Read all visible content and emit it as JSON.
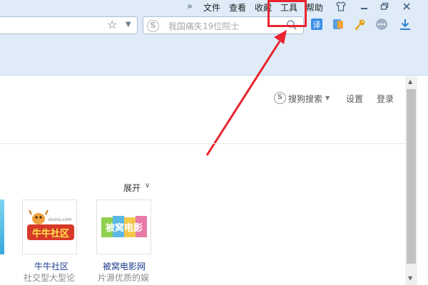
{
  "menubar": {
    "overflow_chevron": "»",
    "items": [
      "文件",
      "查看",
      "收藏",
      "工具",
      "帮助"
    ],
    "window_controls": [
      "shirt-icon",
      "minimize-icon",
      "restore-icon",
      "close-icon"
    ]
  },
  "toolbar": {
    "search_placeholder": "我国痛失19位院士",
    "search_logo_glyph": "S",
    "addon_icons": [
      "translate-icon",
      "sidebar-icon",
      "key-icon",
      "more-icon",
      "download-icon"
    ]
  },
  "highlight": {
    "target": "工具",
    "color": "#e8242f"
  },
  "page": {
    "sogou_search_label": "搜狗搜索",
    "settings_label": "设置",
    "login_label": "登录",
    "expand_label": "展开",
    "tiles": [
      {
        "logo_text": "牛牛社区",
        "logo_small": "niuniu.com",
        "name": "牛牛社区",
        "desc": "社交型大型论"
      },
      {
        "logo_text": "被窝电影",
        "name": "被窝电影网",
        "desc": "片源优质的娱"
      }
    ]
  },
  "colors": {
    "chrome_bg": "#dfecf8",
    "accent": "#3a8ee6",
    "link": "#1a3b8c",
    "arrow": "#e8242f"
  }
}
